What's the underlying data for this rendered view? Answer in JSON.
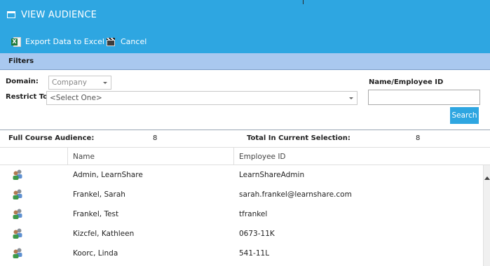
{
  "window": {
    "title": "VIEW AUDIENCE"
  },
  "toolbar": {
    "export_label": "Export Data to Excel",
    "cancel_label": "Cancel"
  },
  "filters": {
    "section_label": "Filters",
    "domain_label": "Domain:",
    "domain_value": "Company",
    "restrict_label": "Restrict To:",
    "restrict_value": "<Select One>",
    "name_id_label": "Name/Employee ID",
    "name_id_value": "",
    "search_label": "Search"
  },
  "summary": {
    "full_label": "Full Course Audience:",
    "full_value": "8",
    "current_label": "Total In Current Selection:",
    "current_value": "8"
  },
  "grid": {
    "columns": [
      "Name",
      "Employee ID"
    ],
    "rows": [
      {
        "icon": "users-icon",
        "name": "Admin, LearnShare",
        "employee_id": "LearnShareAdmin"
      },
      {
        "icon": "users-icon",
        "name": "Frankel, Sarah",
        "employee_id": "sarah.frankel@learnshare.com"
      },
      {
        "icon": "users-icon",
        "name": "Frankel, Test",
        "employee_id": "tfrankel"
      },
      {
        "icon": "users-icon",
        "name": "Kizcfel, Kathleen",
        "employee_id": "0673-11K"
      },
      {
        "icon": "users-icon",
        "name": "Koorc, Linda",
        "employee_id": "541-11L"
      }
    ]
  },
  "colors": {
    "accent": "#2ea6e1",
    "filters_bar": "#a9c8ef",
    "excel_green": "#1f7a3c"
  }
}
